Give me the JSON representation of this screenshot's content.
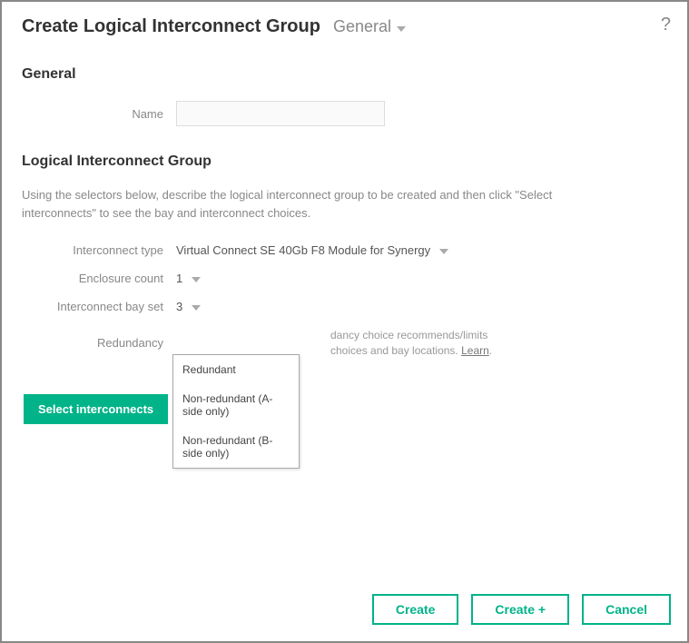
{
  "header": {
    "title": "Create Logical Interconnect Group",
    "section": "General",
    "help": "?"
  },
  "general": {
    "heading": "General",
    "name_label": "Name",
    "name_value": ""
  },
  "lig": {
    "heading": "Logical Interconnect Group",
    "description": "Using the selectors below, describe the logical interconnect group to be created and then click \"Select interconnects\" to see the bay and interconnect choices.",
    "interconnect_type_label": "Interconnect type",
    "interconnect_type_value": "Virtual Connect SE 40Gb F8 Module for Synergy",
    "enclosure_count_label": "Enclosure count",
    "enclosure_count_value": "1",
    "bay_set_label": "Interconnect bay set",
    "bay_set_value": "3",
    "redundancy_label": "Redundancy",
    "redundancy_info_part1": "dancy choice recommends/limits",
    "redundancy_info_part2": "choices and bay locations. ",
    "learn_link": "Learn",
    "redundancy_info_end": ".",
    "options": [
      "Redundant",
      "Non-redundant (A-side only)",
      "Non-redundant (B-side only)"
    ]
  },
  "buttons": {
    "select_interconnects": "Select interconnects",
    "create": "Create",
    "create_plus": "Create +",
    "cancel": "Cancel"
  }
}
